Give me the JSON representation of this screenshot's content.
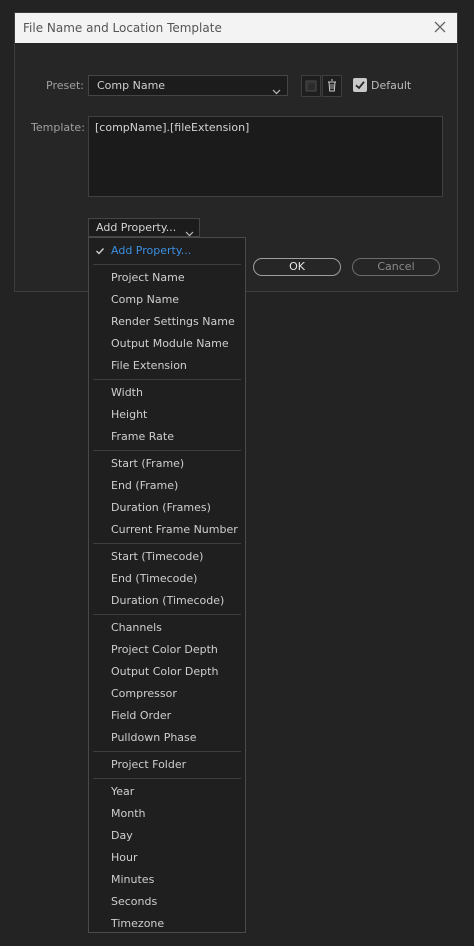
{
  "dialog": {
    "title": "File Name and Location Template",
    "preset_label": "Preset:",
    "preset_value": "Comp Name",
    "default_label": "Default",
    "default_checked": true,
    "template_label": "Template:",
    "template_value": "[compName].[fileExtension]",
    "add_property_label": "Add Property...",
    "ok_label": "OK",
    "cancel_label": "Cancel"
  },
  "menu": {
    "selected": "Add Property...",
    "groups": [
      [
        "Project Name",
        "Comp Name",
        "Render Settings Name",
        "Output Module Name",
        "File Extension"
      ],
      [
        "Width",
        "Height",
        "Frame Rate"
      ],
      [
        "Start (Frame)",
        "End (Frame)",
        "Duration (Frames)",
        "Current Frame Number"
      ],
      [
        "Start (Timecode)",
        "End (Timecode)",
        "Duration (Timecode)"
      ],
      [
        "Channels",
        "Project Color Depth",
        "Output Color Depth",
        "Compressor",
        "Field Order",
        "Pulldown Phase"
      ],
      [
        "Project Folder"
      ],
      [
        "Year",
        "Month",
        "Day",
        "Hour",
        "Minutes",
        "Seconds",
        "Timezone"
      ]
    ]
  },
  "colors": {
    "accent": "#3b8fe0",
    "background": "#232323",
    "titlebar": "#f3f3f3"
  }
}
